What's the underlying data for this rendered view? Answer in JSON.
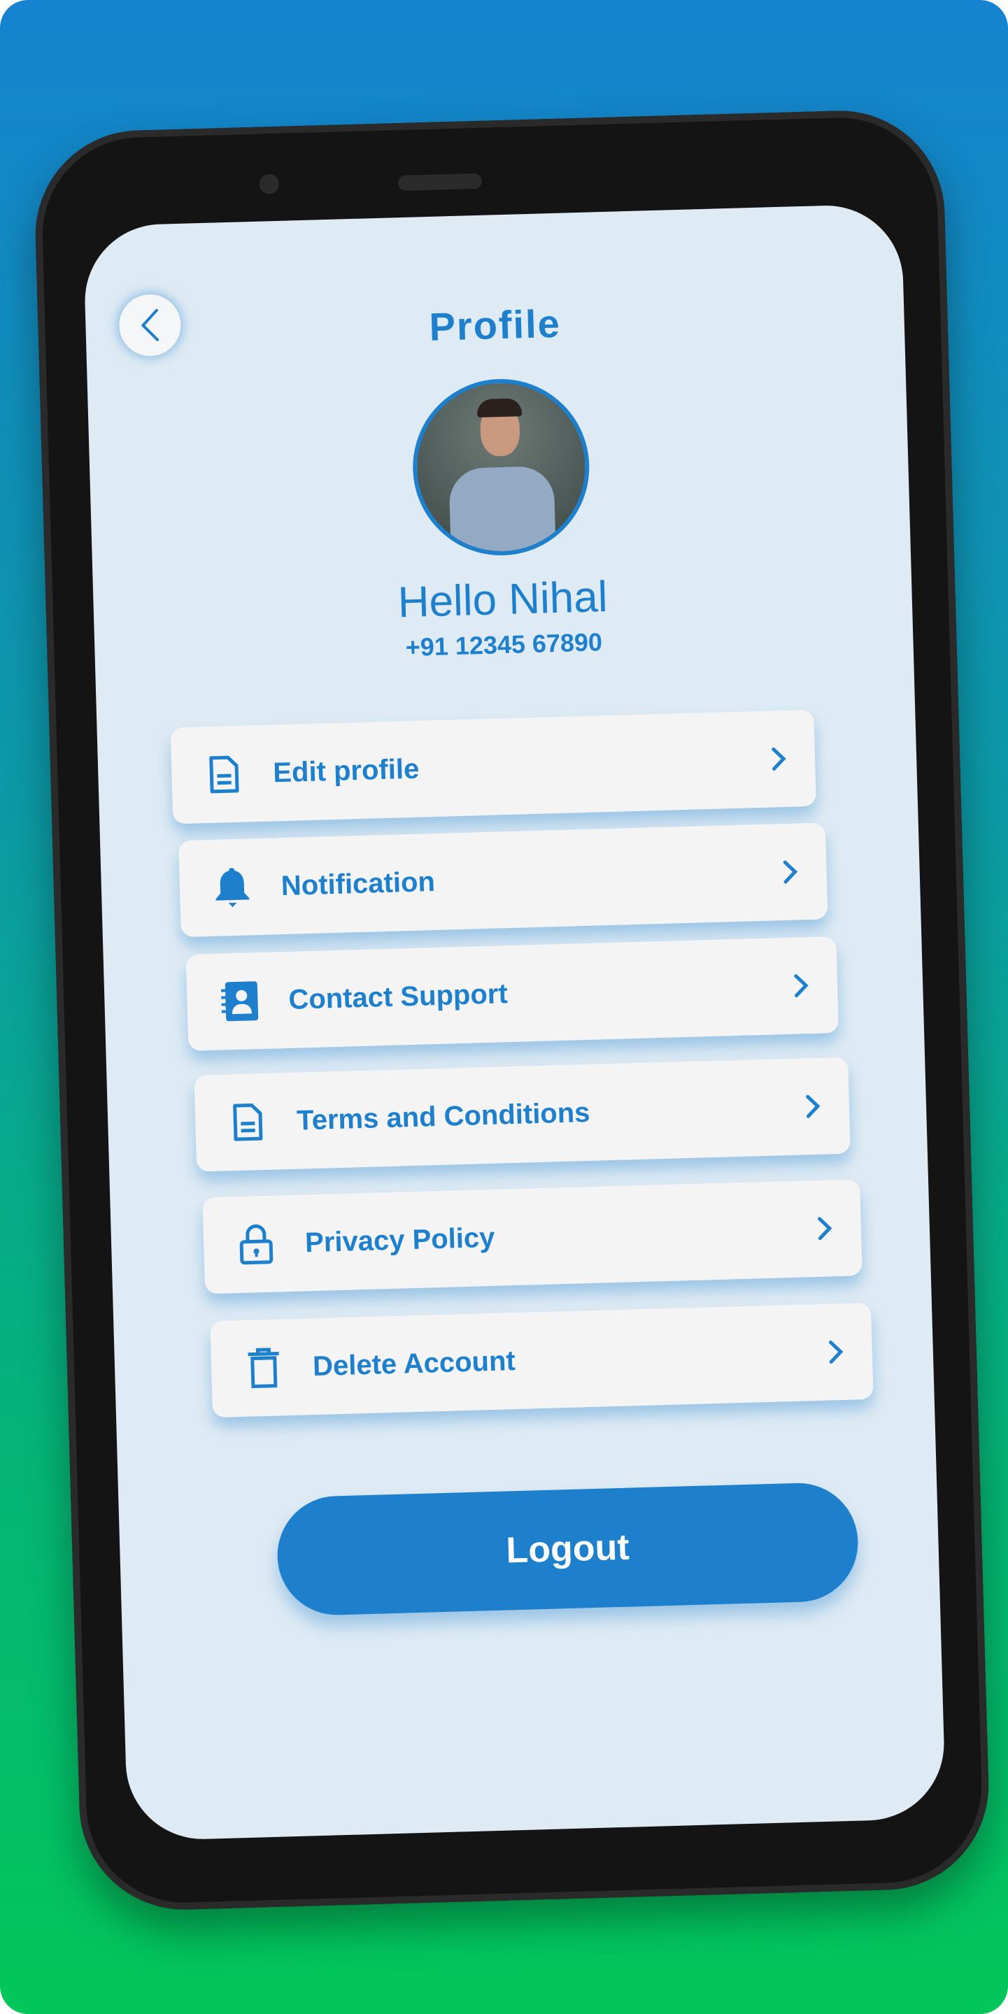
{
  "colors": {
    "accent": "#1e7fcc",
    "screen_bg": "#dfebf4",
    "gradient_top": "#1583cf",
    "gradient_bottom": "#02c65a"
  },
  "header": {
    "title": "Profile",
    "back_icon": "chevron-left-icon"
  },
  "profile": {
    "greeting": "Hello Nihal",
    "phone": "+91 12345 67890"
  },
  "menu": [
    {
      "label": "Edit profile",
      "icon": "document-icon"
    },
    {
      "label": "Notification",
      "icon": "bell-icon"
    },
    {
      "label": "Contact Support",
      "icon": "contact-book-icon"
    },
    {
      "label": "Terms and Conditions",
      "icon": "document-icon"
    },
    {
      "label": "Privacy Policy",
      "icon": "lock-icon"
    },
    {
      "label": "Delete Account",
      "icon": "trash-icon"
    }
  ],
  "logout_label": "Logout"
}
